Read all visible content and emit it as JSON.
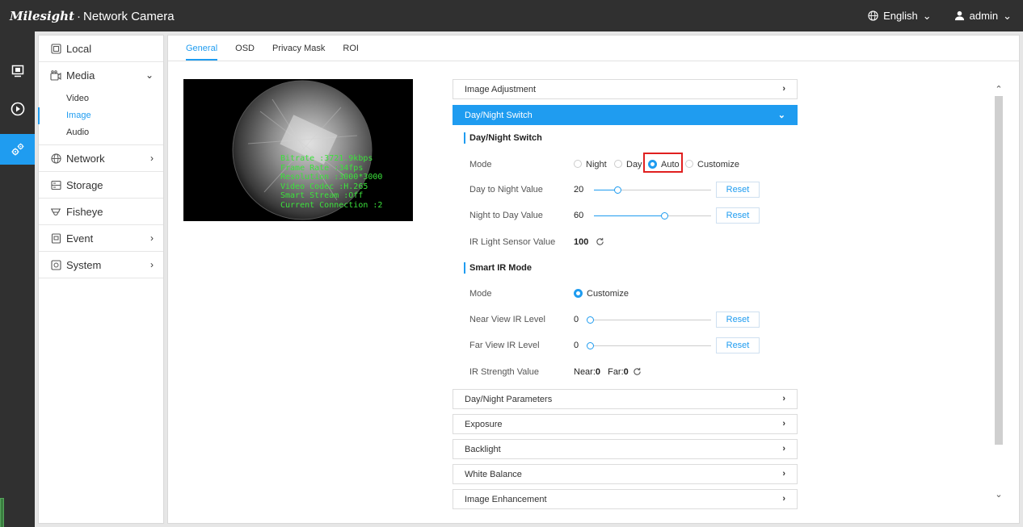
{
  "header": {
    "brand": "Milesight",
    "product": "Network Camera",
    "language": "English",
    "user": "admin"
  },
  "rail": {
    "icons": [
      "live-view-icon",
      "playback-icon",
      "settings-icon"
    ]
  },
  "sidebar": {
    "items": [
      {
        "label": "Local",
        "icon": "local-icon"
      },
      {
        "label": "Media",
        "icon": "media-icon",
        "expanded": true,
        "children": [
          "Video",
          "Image",
          "Audio"
        ],
        "active_child": "Image"
      },
      {
        "label": "Network",
        "icon": "globe-icon"
      },
      {
        "label": "Storage",
        "icon": "storage-icon"
      },
      {
        "label": "Fisheye",
        "icon": "fisheye-icon"
      },
      {
        "label": "Event",
        "icon": "event-icon"
      },
      {
        "label": "System",
        "icon": "system-icon"
      }
    ]
  },
  "tabs": [
    "General",
    "OSD",
    "Privacy Mask",
    "ROI"
  ],
  "active_tab": "General",
  "preview": {
    "osd_lines": [
      "Bitrate :3721.9kbps",
      "Frame Rate :34fps",
      "Resolution :3000*3000",
      "Video Codec :H.265",
      "Smart Stream :Off",
      "Current Connection :2"
    ]
  },
  "panels": {
    "image_adjustment": "Image Adjustment",
    "day_night_switch": "Day/Night Switch",
    "day_night_parameters": "Day/Night Parameters",
    "exposure": "Exposure",
    "backlight": "Backlight",
    "white_balance": "White Balance",
    "image_enhancement": "Image Enhancement"
  },
  "day_night": {
    "section_title": "Day/Night Switch",
    "mode_label": "Mode",
    "modes": [
      "Night",
      "Day",
      "Auto",
      "Customize"
    ],
    "selected_mode": "Auto",
    "day_to_night_label": "Day to Night Value",
    "day_to_night_value": "20",
    "day_to_night_fraction": 0.2,
    "night_to_day_label": "Night to Day Value",
    "night_to_day_value": "60",
    "night_to_day_fraction": 0.6,
    "ir_sensor_label": "IR Light Sensor Value",
    "ir_sensor_value": "100",
    "reset_label": "Reset"
  },
  "smart_ir": {
    "section_title": "Smart IR Mode",
    "mode_label": "Mode",
    "mode_value": "Customize",
    "near_label": "Near View IR Level",
    "near_value": "0",
    "far_label": "Far View IR Level",
    "far_value": "0",
    "strength_label": "IR Strength Value",
    "strength_near_label": "Near:",
    "strength_near_value": "0",
    "strength_far_label": "Far:",
    "strength_far_value": "0",
    "reset_label": "Reset"
  },
  "colors": {
    "accent": "#1f9cf0",
    "topbar": "#303030",
    "highlight": "#e02020",
    "osd_text": "#3ce23c"
  }
}
